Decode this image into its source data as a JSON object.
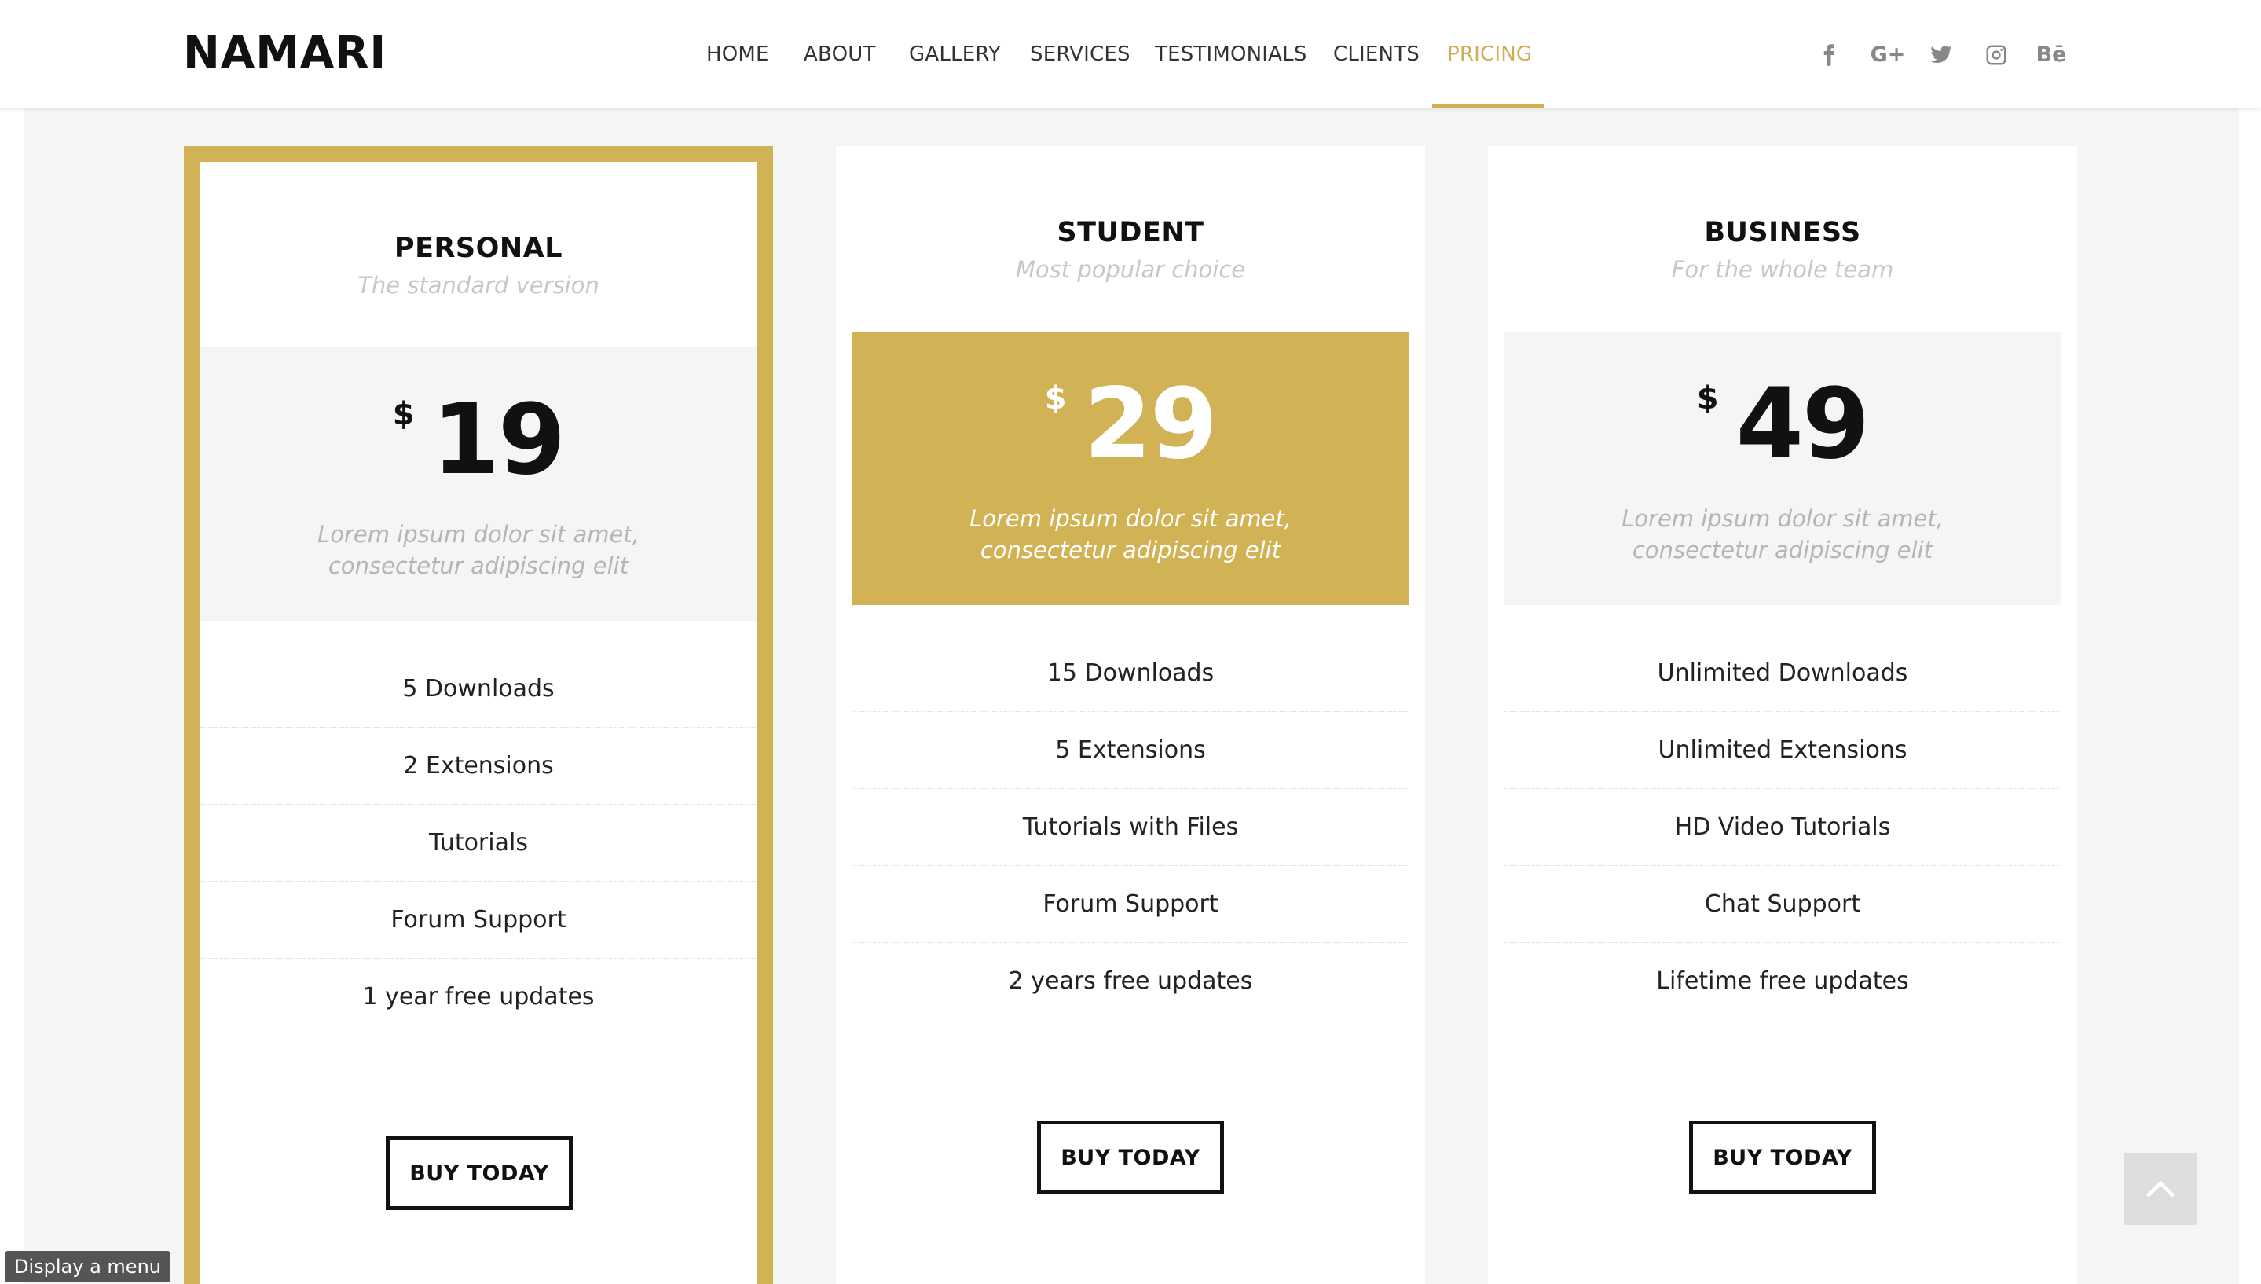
{
  "brand": {
    "logo": "NAMARI",
    "accent_color": "#d1b255"
  },
  "nav": {
    "items": [
      {
        "label": "HOME"
      },
      {
        "label": "ABOUT"
      },
      {
        "label": "GALLERY"
      },
      {
        "label": "SERVICES"
      },
      {
        "label": "TESTIMONIALS"
      },
      {
        "label": "CLIENTS"
      },
      {
        "label": "PRICING",
        "active": true
      }
    ]
  },
  "social": {
    "icons": [
      "facebook-icon",
      "google-plus-icon",
      "twitter-icon",
      "instagram-icon",
      "behance-icon"
    ],
    "google_plus_text": "G+",
    "behance_text": "Bē"
  },
  "pricing": {
    "plans": [
      {
        "name": "PERSONAL",
        "subtitle": "The standard version",
        "currency": "$",
        "price": "19",
        "description": "Lorem ipsum dolor sit amet, consectetur adipiscing elit",
        "features": [
          "5 Downloads",
          "2 Extensions",
          "Tutorials",
          "Forum Support",
          "1 year free updates"
        ],
        "button": "BUY TODAY",
        "featured_border": true,
        "price_highlight": false
      },
      {
        "name": "STUDENT",
        "subtitle": "Most popular choice",
        "currency": "$",
        "price": "29",
        "description": "Lorem ipsum dolor sit amet, consectetur adipiscing elit",
        "features": [
          "15 Downloads",
          "5 Extensions",
          "Tutorials with Files",
          "Forum Support",
          "2 years free updates"
        ],
        "button": "BUY TODAY",
        "featured_border": false,
        "price_highlight": true
      },
      {
        "name": "BUSINESS",
        "subtitle": "For the whole team",
        "currency": "$",
        "price": "49",
        "description": "Lorem ipsum dolor sit amet, consectetur adipiscing elit",
        "features": [
          "Unlimited Downloads",
          "Unlimited Extensions",
          "HD Video Tutorials",
          "Chat Support",
          "Lifetime free updates"
        ],
        "button": "BUY TODAY",
        "featured_border": false,
        "price_highlight": false
      }
    ]
  },
  "back_to_top": {
    "icon": "chevron-up-icon"
  },
  "tooltip": {
    "text": "Display a menu"
  }
}
